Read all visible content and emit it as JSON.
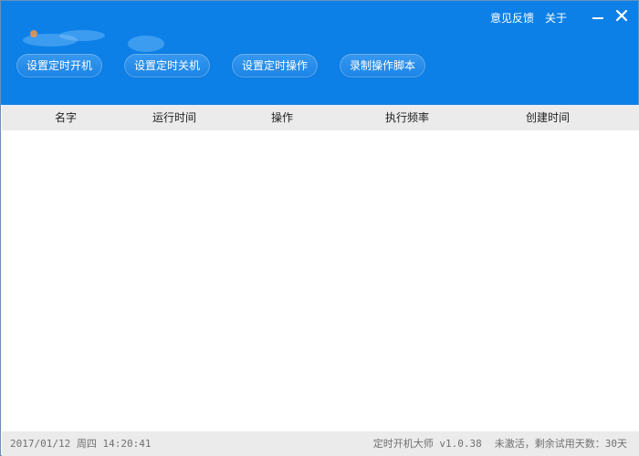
{
  "header": {
    "links": {
      "feedback": "意见反馈",
      "about": "关于"
    },
    "toolbar": {
      "btn1": "设置定时开机",
      "btn2": "设置定时关机",
      "btn3": "设置定时操作",
      "btn4": "录制操作脚本"
    }
  },
  "table": {
    "columns": [
      "名字",
      "运行时间",
      "操作",
      "执行频率",
      "创建时间"
    ],
    "rows": []
  },
  "status": {
    "datetime": "2017/01/12 周四 14:20:41",
    "app_version": "定时开机大师 v1.0.38",
    "activation": "未激活，剩余试用天数：30天"
  },
  "colors": {
    "accent": "#0d80e8",
    "header_bg": "#ebebeb"
  }
}
